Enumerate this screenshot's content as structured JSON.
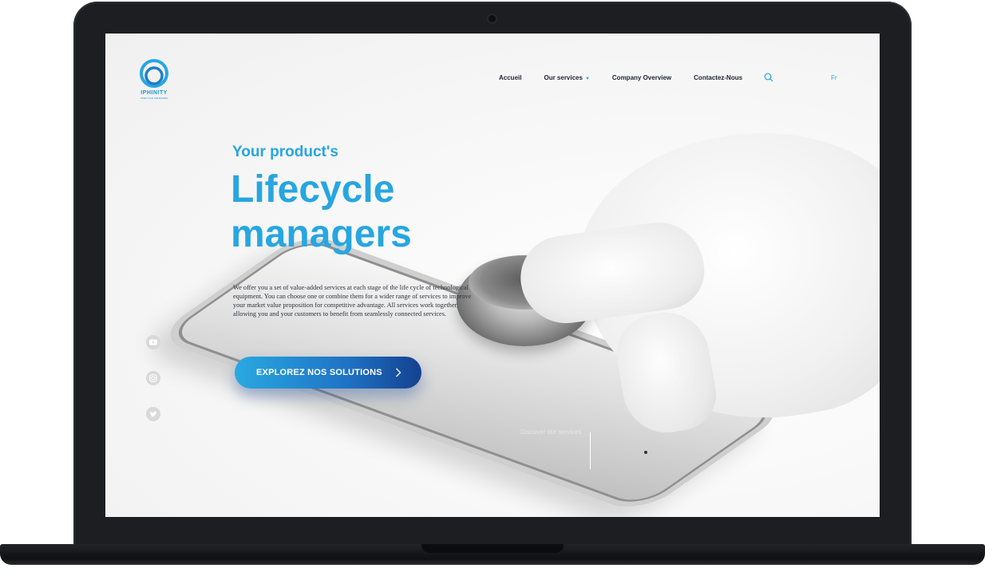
{
  "header": {
    "logo_text": "IPHINITY",
    "logo_subtext": "LIFECYCLE MANAGERS",
    "nav": [
      {
        "label": "Accueil"
      },
      {
        "label": "Our services",
        "has_dropdown": true
      },
      {
        "label": "Company Overview"
      },
      {
        "label": "Contactez-Nous"
      }
    ],
    "language": "Fr"
  },
  "hero": {
    "kicker": "Your product's",
    "title_line1": "Lifecycle",
    "title_line2": "managers",
    "description": "We offer you a set of value-added services at each stage of the life cycle of technological equipment. You can choose one or combine them for a wider range of services to improve your market value proposition for competitive advantage. All services work together, allowing you and your customers to benefit from seamlessly connected services.",
    "cta_label": "EXPLOREZ NOS SOLUTIONS",
    "scroll_label": "Discover our services"
  },
  "social": [
    "youtube-icon",
    "instagram-icon",
    "twitter-icon"
  ],
  "colors": {
    "accent": "#27a6e0",
    "cta_dark": "#14418f",
    "nav_text": "#1f2533",
    "laptop_frame": "#1d1e22"
  }
}
